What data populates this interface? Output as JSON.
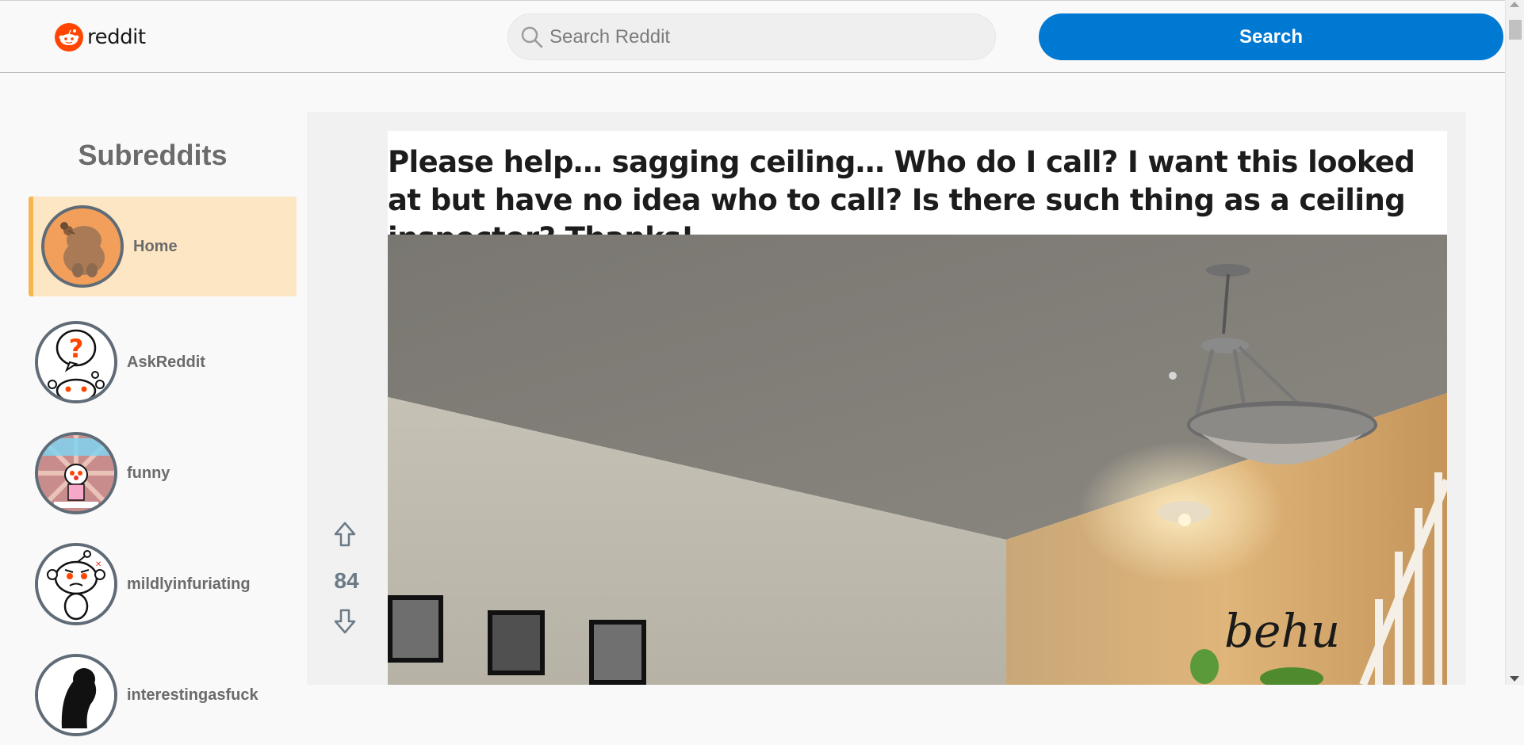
{
  "header": {
    "logo_text": "reddit",
    "search_placeholder": "Search Reddit",
    "search_button": "Search"
  },
  "sidebar": {
    "title": "Subreddits",
    "items": [
      {
        "label": "Home",
        "active": true
      },
      {
        "label": "AskReddit",
        "active": false
      },
      {
        "label": "funny",
        "active": false
      },
      {
        "label": "mildlyinfuriating",
        "active": false
      },
      {
        "label": "interestingasfuck",
        "active": false
      }
    ]
  },
  "post": {
    "title": "Please help… sagging ceiling… Who do I call? I want this looked at but have no idea who to call? Is there such thing as a ceiling inspector? Thanks!",
    "votes": "84",
    "image_alt_words": "behu"
  },
  "colors": {
    "brand": "#ff4500",
    "accent": "#0079d3",
    "active_bg": "#fde6c3",
    "active_border": "#f7b54d"
  }
}
